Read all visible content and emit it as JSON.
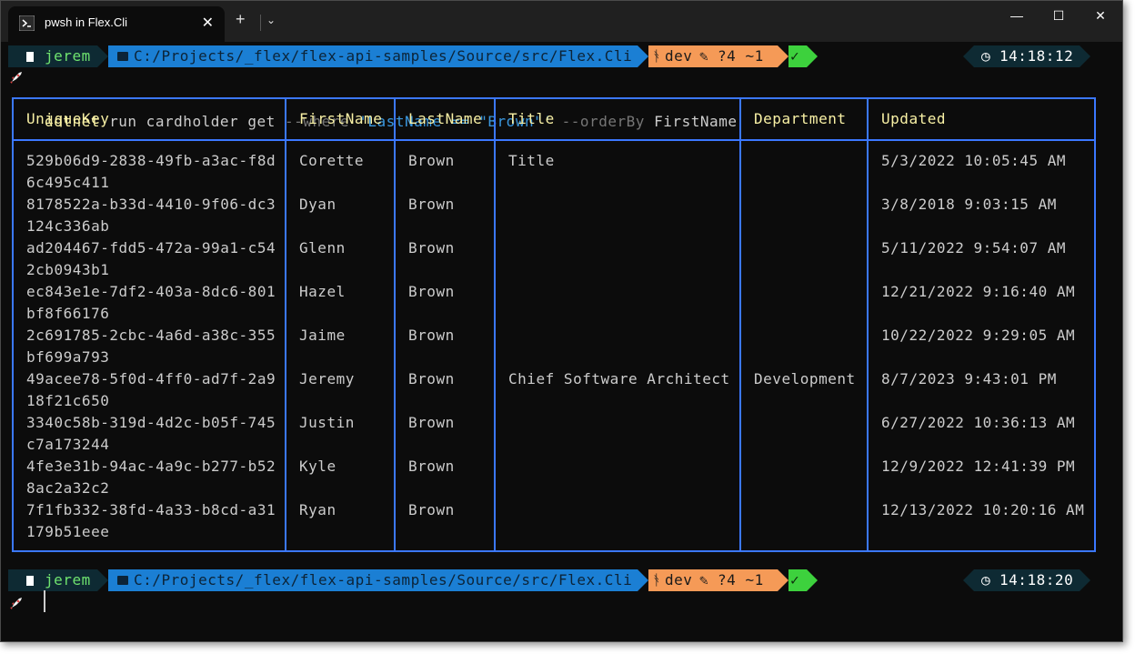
{
  "window": {
    "tab_title": "pwsh in Flex.Cli",
    "tab_close": "✕",
    "new_tab": "+",
    "dropdown": "⌄",
    "minimize": "—",
    "maximize": "☐",
    "close": "✕"
  },
  "colors": {
    "user_segment_bg": "#0e2a33",
    "user_text": "#6fe36f",
    "path_segment_bg": "#1b7fd4",
    "git_segment_bg": "#f59a57",
    "status_ok_bg": "#3dd13d",
    "time_segment_bg": "#0e2a33",
    "table_border": "#3b78ff",
    "header_text": "#f9f1a5"
  },
  "prompts": [
    {
      "user": "jerem",
      "path": "C:/Projects/_flex/flex-api-samples/Source/src/Flex.Cli",
      "branch": "dev",
      "git_status": "?4 ~1",
      "status_icon": "✓",
      "time": "14:18:12"
    },
    {
      "user": "jerem",
      "path": "C:/Projects/_flex/flex-api-samples/Source/src/Flex.Cli",
      "branch": "dev",
      "git_status": "?4 ~1",
      "status_icon": "✓",
      "time": "14:18:20"
    }
  ],
  "command": {
    "exe": "dotnet",
    "args": " run cardholder get ",
    "flag1": "--where",
    "string": " 'LastName == \"Brown\"' ",
    "flag2": "--orderBy",
    "value": " FirstName"
  },
  "table": {
    "headers": [
      "UniqueKey",
      "FirstName",
      "LastName",
      "Title",
      "Department",
      "Updated"
    ],
    "rows": [
      {
        "key": "529b06d9-2838-49fb-a3ac-f8d\n6c495c411",
        "first": "Corette",
        "last": "Brown",
        "title": "Title",
        "dept": "",
        "updated": "5/3/2022 10:05:45 AM"
      },
      {
        "key": "8178522a-b33d-4410-9f06-dc3\n124c336ab",
        "first": "Dyan",
        "last": "Brown",
        "title": "",
        "dept": "",
        "updated": "3/8/2018 9:03:15 AM"
      },
      {
        "key": "ad204467-fdd5-472a-99a1-c54\n2cb0943b1",
        "first": "Glenn",
        "last": "Brown",
        "title": "",
        "dept": "",
        "updated": "5/11/2022 9:54:07 AM"
      },
      {
        "key": "ec843e1e-7df2-403a-8dc6-801\nbf8f66176",
        "first": "Hazel",
        "last": "Brown",
        "title": "",
        "dept": "",
        "updated": "12/21/2022 9:16:40 AM"
      },
      {
        "key": "2c691785-2cbc-4a6d-a38c-355\nbf699a793",
        "first": "Jaime",
        "last": "Brown",
        "title": "",
        "dept": "",
        "updated": "10/22/2022 9:29:05 AM"
      },
      {
        "key": "49acee78-5f0d-4ff0-ad7f-2a9\n18f21c650",
        "first": "Jeremy",
        "last": "Brown",
        "title": "Chief Software Architect",
        "dept": "Development",
        "updated": "8/7/2023 9:43:01 PM"
      },
      {
        "key": "3340c58b-319d-4d2c-b05f-745\nc7a173244",
        "first": "Justin",
        "last": "Brown",
        "title": "",
        "dept": "",
        "updated": "6/27/2022 10:36:13 AM"
      },
      {
        "key": "4fe3e31b-94ac-4a9c-b277-b52\n8ac2a32c2",
        "first": "Kyle",
        "last": "Brown",
        "title": "",
        "dept": "",
        "updated": "12/9/2022 12:41:39 PM"
      },
      {
        "key": "7f1fb332-38fd-4a33-b8cd-a31\n179b51eee",
        "first": "Ryan",
        "last": "Brown",
        "title": "",
        "dept": "",
        "updated": "12/13/2022 10:20:16 AM"
      }
    ]
  }
}
